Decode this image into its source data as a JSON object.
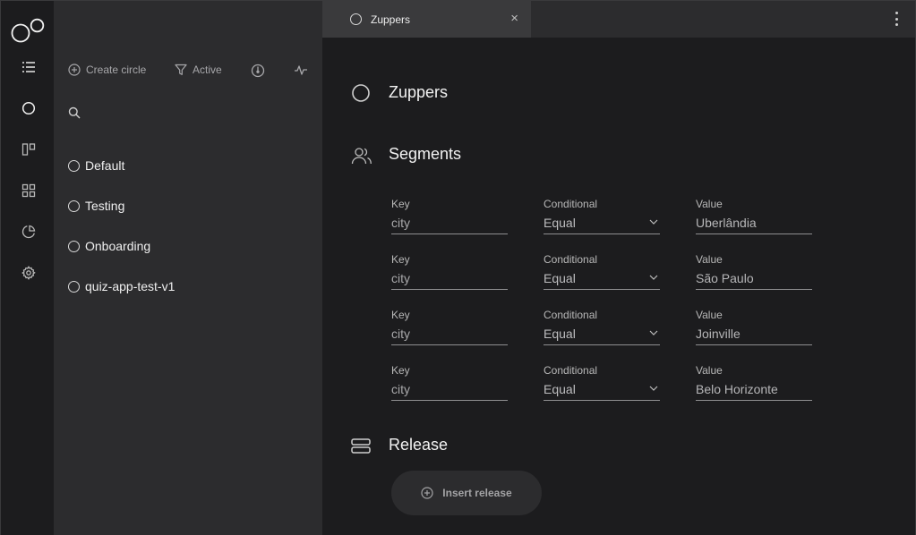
{
  "rail": {
    "items": [
      {
        "name": "list-icon"
      },
      {
        "name": "circle-icon"
      },
      {
        "name": "board-icon"
      },
      {
        "name": "grid-icon"
      },
      {
        "name": "pie-chart-icon"
      },
      {
        "name": "gear-icon"
      }
    ]
  },
  "toolbar": {
    "create_label": "Create circle",
    "filter_label": "Active"
  },
  "search": {
    "placeholder": "",
    "value": ""
  },
  "circles": [
    {
      "label": "Default"
    },
    {
      "label": "Testing"
    },
    {
      "label": "Onboarding"
    },
    {
      "label": "quiz-app-test-v1"
    }
  ],
  "tab": {
    "label": "Zuppers",
    "close": "×"
  },
  "detail": {
    "title": "Zuppers",
    "segments_title": "Segments",
    "release_title": "Release",
    "insert_release_label": "Insert release",
    "segments": [
      {
        "key_label": "Key",
        "key": "city",
        "cond_label": "Conditional",
        "cond": "Equal",
        "value_label": "Value",
        "value": "Uberlândia"
      },
      {
        "key_label": "Key",
        "key": "city",
        "cond_label": "Conditional",
        "cond": "Equal",
        "value_label": "Value",
        "value": "São Paulo"
      },
      {
        "key_label": "Key",
        "key": "city",
        "cond_label": "Conditional",
        "cond": "Equal",
        "value_label": "Value",
        "value": "Joinville"
      },
      {
        "key_label": "Key",
        "key": "city",
        "cond_label": "Conditional",
        "cond": "Equal",
        "value_label": "Value",
        "value": "Belo Horizonte"
      }
    ]
  },
  "colors": {
    "background": "#1c1c1e",
    "panel": "#2c2c2e",
    "active_tab": "#3a3a3c"
  }
}
